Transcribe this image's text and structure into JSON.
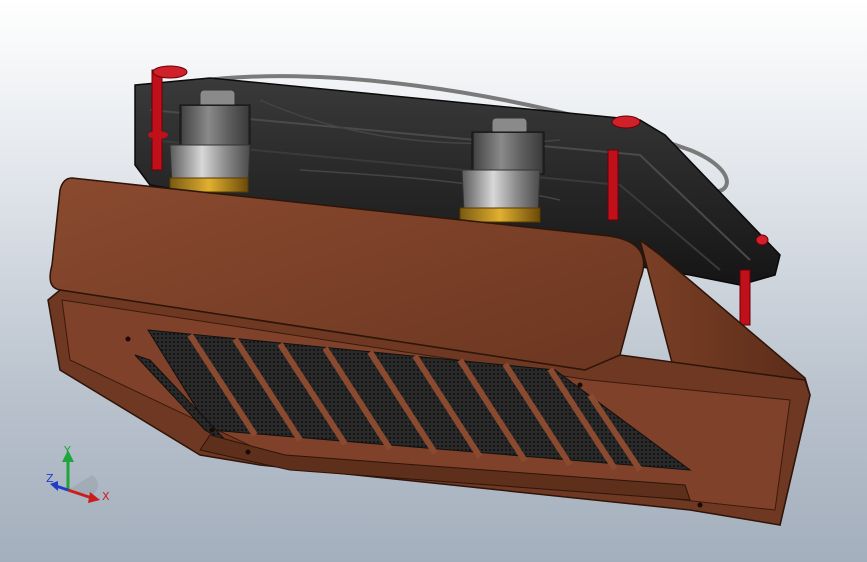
{
  "viewport": {
    "background_top": "#ffffff",
    "background_bottom": "#a4afbd"
  },
  "model": {
    "radiator_color": "#7a3f27",
    "radiator_dark": "#4a2416",
    "fan_color": "#2b2b2b",
    "screw_color": "#c0101a",
    "fitting_color": "#9a9a9a",
    "grille_color": "#1a1a1a"
  },
  "triad": {
    "x_label": "X",
    "y_label": "Y",
    "z_label": "Z",
    "x_color": "#c81e1e",
    "y_color": "#1fa63a",
    "z_color": "#1e3ec8"
  }
}
